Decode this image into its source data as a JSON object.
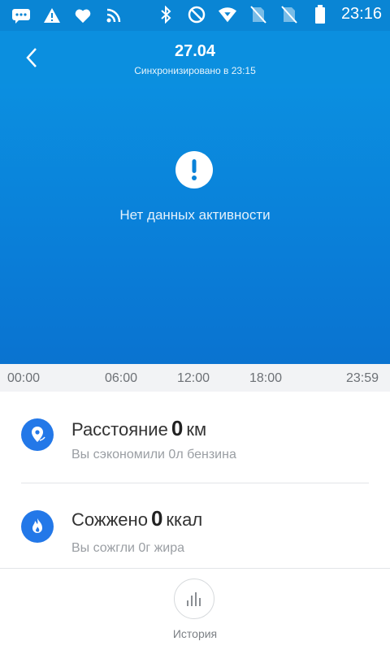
{
  "status_bar": {
    "left_icons": [
      "chat-icon",
      "warning-icon",
      "heart-icon",
      "rss-icon"
    ],
    "right_icons": [
      "bluetooth-icon",
      "do-not-disturb-icon",
      "wifi-icon",
      "no-sim-icon",
      "no-sim-icon",
      "battery-icon"
    ],
    "time": "23:16"
  },
  "header": {
    "back_icon": "back-icon",
    "title": "27.04",
    "subtitle": "Синхронизировано в 23:15"
  },
  "hero": {
    "icon": "alert-icon",
    "message": "Нет данных активности"
  },
  "timeline": {
    "labels": [
      "00:00",
      "06:00",
      "12:00",
      "18:00",
      "23:59"
    ]
  },
  "cards": [
    {
      "icon": "location-icon",
      "title": "Расстояние",
      "value": "0",
      "unit": "км",
      "subtitle": "Вы сэкономили 0л бензина"
    },
    {
      "icon": "flame-icon",
      "title": "Сожжено",
      "value": "0",
      "unit": "ккал",
      "subtitle": "Вы сожгли 0г жира"
    }
  ],
  "bottom": {
    "history_icon": "bar-chart-icon",
    "history_label": "История"
  },
  "colors": {
    "header": "#0b8fdf",
    "hero_top": "#0b8fe0",
    "hero_bottom": "#0a73d0",
    "icon_blue": "#2378e8"
  }
}
